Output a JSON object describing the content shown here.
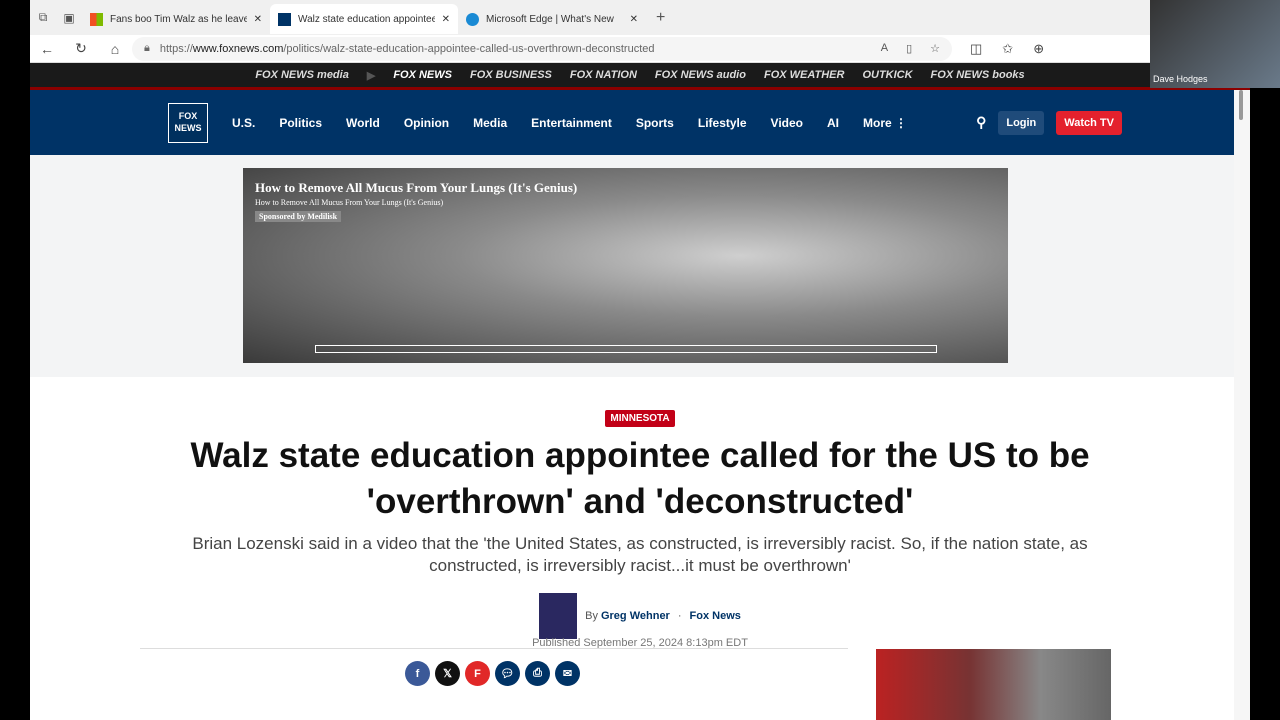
{
  "tabs": [
    {
      "title": "Fans boo Tim Walz as he leaves M",
      "active": false
    },
    {
      "title": "Walz state education appointee c",
      "active": true
    },
    {
      "title": "Microsoft Edge | What's New",
      "active": false
    }
  ],
  "url": {
    "prefix": "https://",
    "domain": "www.foxnews.com",
    "path": "/politics/walz-state-education-appointee-called-us-overthrown-deconstructed"
  },
  "network": [
    "FOX NEWS media",
    "FOX NEWS",
    "FOX BUSINESS",
    "FOX NATION",
    "FOX NEWS audio",
    "FOX WEATHER",
    "OUTKICK",
    "FOX NEWS books"
  ],
  "logo": "FOX NEWS channel",
  "menu": [
    "U.S.",
    "Politics",
    "World",
    "Opinion",
    "Media",
    "Entertainment",
    "Sports",
    "Lifestyle",
    "Video",
    "AI",
    "More ⋮"
  ],
  "header": {
    "login": "Login",
    "watch": "Watch TV"
  },
  "ad": {
    "title": "How to Remove All Mucus From Your Lungs (It's Genius)",
    "subtitle": "How to Remove All Mucus From Your Lungs (It's Genius)",
    "sponsor": "Sponsored by Medilisk"
  },
  "article": {
    "tag": "MINNESOTA",
    "headline": "Walz state education appointee called for the US to be 'overthrown' and 'deconstructed'",
    "dek": "Brian Lozenski said in a video that the 'the United States, as constructed, is irreversibly racist. So, if the nation state, as constructed, is irreversibly racist...it must be overthrown'",
    "by": "By",
    "author": "Greg Wehner",
    "outlet": "Fox News",
    "published": "Published September 25, 2024 8:13pm EDT"
  },
  "webcam": {
    "name": "Dave Hodges"
  }
}
